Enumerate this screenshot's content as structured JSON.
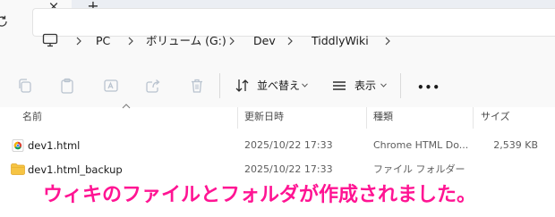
{
  "tab": {
    "close_glyph": "×",
    "new_glyph": "+"
  },
  "address": {
    "icon": "pc-icon",
    "crumbs": [
      "PC",
      "ボリューム (G:)",
      "Dev",
      "TiddlyWiki"
    ]
  },
  "toolbar": {
    "sort_label": "並べ替え",
    "view_label": "表示",
    "more_label": "•••"
  },
  "columns": {
    "name": "名前",
    "modified": "更新日時",
    "type": "種類",
    "size": "サイズ"
  },
  "files": [
    {
      "icon": "chrome-icon",
      "name": "dev1.html",
      "modified": "2025/10/22 17:33",
      "type": "Chrome HTML Do...",
      "size": "2,539 KB"
    },
    {
      "icon": "folder-icon",
      "name": "dev1.html_backup",
      "modified": "2025/10/22 17:33",
      "type": "ファイル フォルダー",
      "size": ""
    }
  ],
  "caption": "ウィキのファイルとフォルダが作成されました。",
  "colors": {
    "caption": "#ff1493",
    "folder": "#f6c443",
    "chrome_red": "#db4437",
    "chrome_green": "#0f9d58",
    "chrome_yellow": "#f4b400",
    "chrome_blue": "#4285f4"
  }
}
